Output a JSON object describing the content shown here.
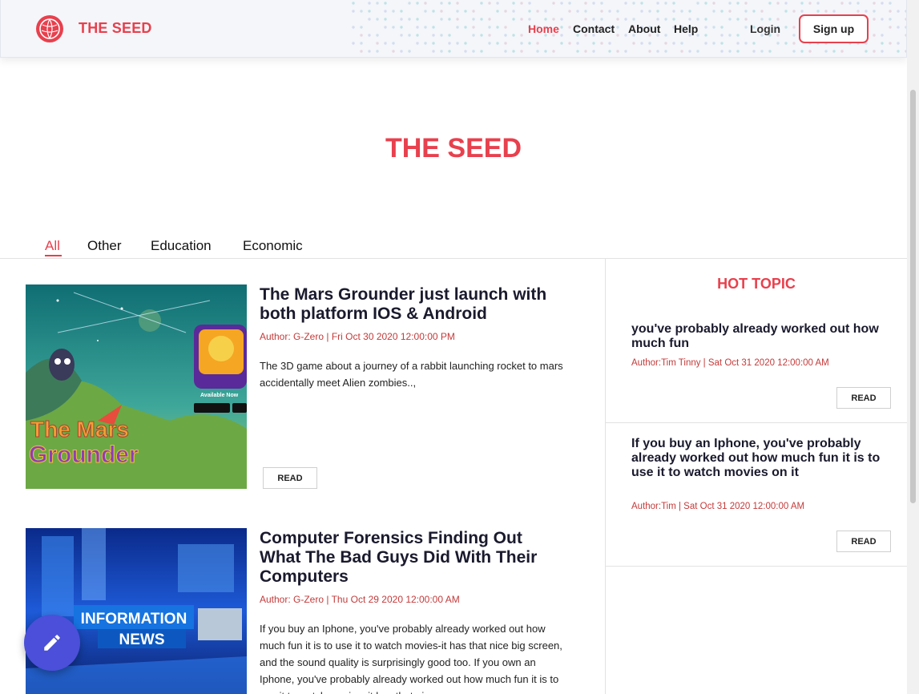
{
  "header": {
    "brand": "THE SEED",
    "nav": [
      {
        "label": "Home",
        "active": true
      },
      {
        "label": "Contact"
      },
      {
        "label": "About"
      },
      {
        "label": "Help"
      }
    ],
    "login_label": "Login",
    "signup_label": "Sign up"
  },
  "hero": {
    "title": "THE SEED"
  },
  "tabs": [
    {
      "label": "All",
      "active": true
    },
    {
      "label": "Other"
    },
    {
      "label": "Education"
    },
    {
      "label": "Economic"
    }
  ],
  "posts": [
    {
      "title": "The Mars Grounder just launch with both platform IOS & Android",
      "meta": "Author: G-Zero | Fri Oct 30 2020 12:00:00 PM",
      "description": "The 3D game about a journey of a rabbit launching rocket to mars accidentally meet Alien zombies..,",
      "read_label": "READ",
      "image_text": {
        "line1": "The Mars",
        "line2": "Grounder",
        "badge": "The Mars Grounder",
        "available": "Available Now"
      }
    },
    {
      "title": "Computer Forensics Finding Out What The Bad Guys Did With Their Computers",
      "meta": "Author: G-Zero | Thu Oct 29 2020 12:00:00 AM",
      "description": "If you buy an Iphone, you've probably already worked out how much fun it is to use it to watch movies-it has that nice big screen, and the sound quality is surprisingly good too. If you own an Iphone, you've probably already worked out how much fun it is to use it to watch movies. it has that nice",
      "image_text": {
        "line1": "INFORMATION",
        "line2": "NEWS"
      }
    }
  ],
  "hot_topic": {
    "title": "HOT TOPIC",
    "items": [
      {
        "title": "you've probably already worked out how much fun",
        "meta": "Author:Tim Tinny | Sat Oct 31 2020 12:00:00 AM",
        "read_label": "READ"
      },
      {
        "title": "If you buy an Iphone, you've probably already worked out how much fun it is to use it to watch movies on it",
        "meta": "Author:Tim | Sat Oct 31 2020 12:00:00 AM",
        "read_label": "READ"
      }
    ]
  },
  "colors": {
    "accent": "#e8404d",
    "fab": "#4b4fd9"
  },
  "icons": {
    "logo": "globe-icon",
    "fab": "pencil-icon"
  }
}
